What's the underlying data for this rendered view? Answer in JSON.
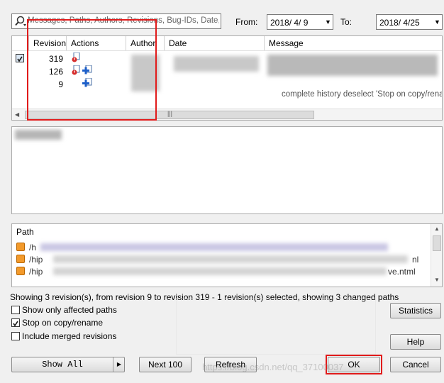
{
  "filter": {
    "placeholder": "Messages, Paths, Authors, Revisions, Bug-IDs, Date,",
    "from_label": "From:",
    "from_date": "2018/ 4/ 9",
    "to_label": "To:",
    "to_date": "2018/ 4/25"
  },
  "revisions": {
    "columns": [
      "Revision",
      "Actions",
      "Author",
      "Date",
      "Message"
    ],
    "rows": [
      {
        "revision": "319"
      },
      {
        "revision": "126"
      },
      {
        "revision": "9"
      }
    ],
    "message_snippet": "complete history deselect 'Stop on copy/renam"
  },
  "paths": {
    "header": "Path",
    "rows": [
      {
        "left": "/h"
      },
      {
        "left": "/hip",
        "right": "nl"
      },
      {
        "left": "/hip",
        "right": "ve.ntml"
      }
    ]
  },
  "status_text": "Showing 3 revision(s), from revision 9 to revision 319 - 1 revision(s) selected, showing 3 changed paths",
  "options": [
    {
      "label": "Show only affected paths",
      "checked": false
    },
    {
      "label": "Stop on copy/rename",
      "checked": true
    },
    {
      "label": "Include merged revisions",
      "checked": false
    }
  ],
  "buttons": {
    "statistics": "Statistics",
    "help": "Help",
    "show_all": "Show All",
    "next_100": "Next 100",
    "refresh": "Refresh",
    "ok": "OK",
    "cancel": "Cancel"
  },
  "watermark": "https://blog.csdn.net/qq_37100037",
  "colors": {
    "highlight_red": "#e11b1b",
    "selection": "#cce8ff"
  }
}
